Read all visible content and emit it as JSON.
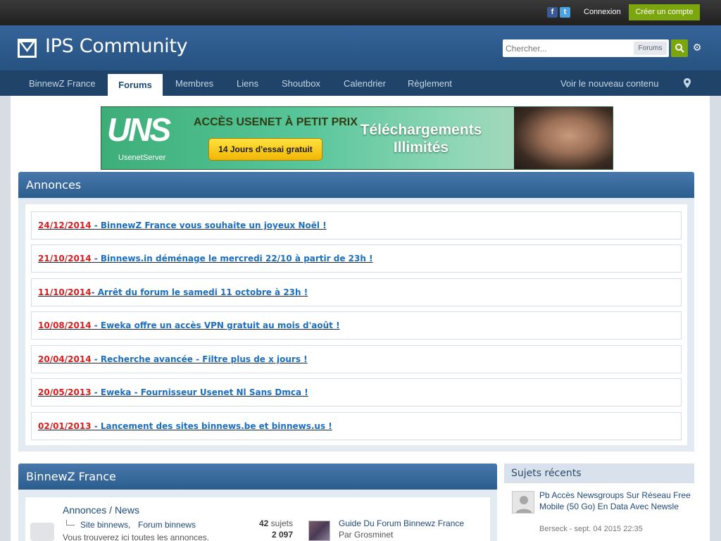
{
  "user_bar": {
    "facebook_icon": "facebook-icon",
    "twitter_icon": "twitter-icon",
    "login_label": "Connexion",
    "register_label": "Créer un compte"
  },
  "header": {
    "site_name": "IPS Community",
    "search": {
      "placeholder": "Chercher...",
      "scope": "Forums"
    },
    "search_icon": "search-icon",
    "options_icon": "gear-icon"
  },
  "nav": {
    "tabs": [
      {
        "label": "BinnewZ France"
      },
      {
        "label": "Forums",
        "active": true
      },
      {
        "label": "Membres"
      },
      {
        "label": "Liens"
      },
      {
        "label": "Shoutbox"
      },
      {
        "label": "Calendrier"
      },
      {
        "label": "Règlement"
      }
    ],
    "new_content_label": "Voir le nouveau contenu",
    "location_icon": "map-marker-icon"
  },
  "ad": {
    "logo": "UNS",
    "sublogo": "UsenetServer",
    "headline": "ACCÈS USENET À PETIT PRIX",
    "cta": "14 Jours d'essai gratuit",
    "tagline": "Téléchargements Illimités"
  },
  "announcements": {
    "title": "Annonces",
    "items": [
      {
        "date": "24/12/2014",
        "title": " - BinnewZ France vous souhaite un joyeux Noël !"
      },
      {
        "date": "21/10/2014",
        "title": " - Binnews.in déménage le mercredi 22/10 à partir de 23h !"
      },
      {
        "date": "11/10/2014",
        "title": "- Arrêt du forum le samedi 11 octobre à 23h !"
      },
      {
        "date": "10/08/2014",
        "title": " - Eweka offre un accès VPN gratuit au mois d'août !"
      },
      {
        "date": "20/04/2014",
        "title": " - Recherche avancée - Filtre plus de x jours !"
      },
      {
        "date": "20/05/2013",
        "title": " - Eweka - Fournisseur Usenet Nl Sans Dmca !"
      },
      {
        "date": "02/01/2013",
        "title": " - Lancement des sites binnews.be et binnews.us !"
      }
    ]
  },
  "category": {
    "title": "BinnewZ France",
    "forum": {
      "name": "Annonces / News",
      "subforums": [
        "Site binnews,",
        "Forum binnews"
      ],
      "description": "Vous trouverez ici toutes les annonces.",
      "topics_num": "42",
      "topics_label": "sujets",
      "posts": "2 097",
      "last_post_title": "Guide Du Forum Binnewz France",
      "last_post_author": "Par Grosminet"
    }
  },
  "sidebar": {
    "title": "Sujets récents",
    "items": [
      {
        "title": "Pb Accès Newsgroups Sur Réseau Free Mobile (50 Go) En Data Avec Newsle",
        "meta": "Berseck - sept. 04 2015 22:35"
      }
    ]
  }
}
